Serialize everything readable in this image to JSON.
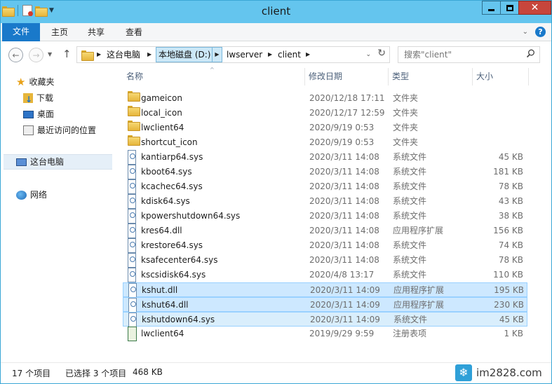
{
  "window": {
    "title": "client"
  },
  "ribbon": {
    "tabs": [
      "文件",
      "主页",
      "共享",
      "查看"
    ]
  },
  "address": {
    "crumbs": [
      "这台电脑",
      "本地磁盘 (D:)",
      "lwserver",
      "client"
    ]
  },
  "search": {
    "placeholder": "搜索\"client\""
  },
  "nav": {
    "favorites": "收藏夹",
    "downloads": "下载",
    "desktop": "桌面",
    "recent": "最近访问的位置",
    "this_pc": "这台电脑",
    "network": "网络"
  },
  "columns": [
    "名称",
    "修改日期",
    "类型",
    "大小"
  ],
  "files": [
    {
      "name": "gameicon",
      "date": "2020/12/18 17:11",
      "type": "文件夹",
      "size": "",
      "icon": "folder-icon"
    },
    {
      "name": "local_icon",
      "date": "2020/12/17 12:59",
      "type": "文件夹",
      "size": "",
      "icon": "folder-icon"
    },
    {
      "name": "lwclient64",
      "date": "2020/9/19 0:53",
      "type": "文件夹",
      "size": "",
      "icon": "folder-icon"
    },
    {
      "name": "shortcut_icon",
      "date": "2020/9/19 0:53",
      "type": "文件夹",
      "size": "",
      "icon": "folder-icon"
    },
    {
      "name": "kantiarp64.sys",
      "date": "2020/3/11 14:08",
      "type": "系统文件",
      "size": "45 KB",
      "icon": "system-file-icon"
    },
    {
      "name": "kboot64.sys",
      "date": "2020/3/11 14:08",
      "type": "系统文件",
      "size": "181 KB",
      "icon": "system-file-icon"
    },
    {
      "name": "kcachec64.sys",
      "date": "2020/3/11 14:08",
      "type": "系统文件",
      "size": "78 KB",
      "icon": "system-file-icon"
    },
    {
      "name": "kdisk64.sys",
      "date": "2020/3/11 14:08",
      "type": "系统文件",
      "size": "43 KB",
      "icon": "system-file-icon"
    },
    {
      "name": "kpowershutdown64.sys",
      "date": "2020/3/11 14:08",
      "type": "系统文件",
      "size": "38 KB",
      "icon": "system-file-icon"
    },
    {
      "name": "kres64.dll",
      "date": "2020/3/11 14:08",
      "type": "应用程序扩展",
      "size": "156 KB",
      "icon": "dll-file-icon"
    },
    {
      "name": "krestore64.sys",
      "date": "2020/3/11 14:08",
      "type": "系统文件",
      "size": "74 KB",
      "icon": "system-file-icon"
    },
    {
      "name": "ksafecenter64.sys",
      "date": "2020/3/11 14:08",
      "type": "系统文件",
      "size": "78 KB",
      "icon": "system-file-icon"
    },
    {
      "name": "kscsidisk64.sys",
      "date": "2020/4/8 13:17",
      "type": "系统文件",
      "size": "110 KB",
      "icon": "system-file-icon"
    },
    {
      "name": "kshut.dll",
      "date": "2020/3/11 14:09",
      "type": "应用程序扩展",
      "size": "195 KB",
      "icon": "dll-file-icon",
      "selected": true
    },
    {
      "name": "kshut64.dll",
      "date": "2020/3/11 14:09",
      "type": "应用程序扩展",
      "size": "230 KB",
      "icon": "dll-file-icon",
      "selected": true
    },
    {
      "name": "kshutdown64.sys",
      "date": "2020/3/11 14:09",
      "type": "系统文件",
      "size": "45 KB",
      "icon": "system-file-icon",
      "selected": true
    },
    {
      "name": "lwclient64",
      "date": "2019/9/29 9:59",
      "type": "注册表项",
      "size": "1 KB",
      "icon": "registry-file-icon"
    }
  ],
  "status": {
    "item_count": "17 个项目",
    "selected": "已选择 3 个项目",
    "selected_size": "468 KB"
  },
  "watermark": {
    "text": "im2828.com"
  }
}
